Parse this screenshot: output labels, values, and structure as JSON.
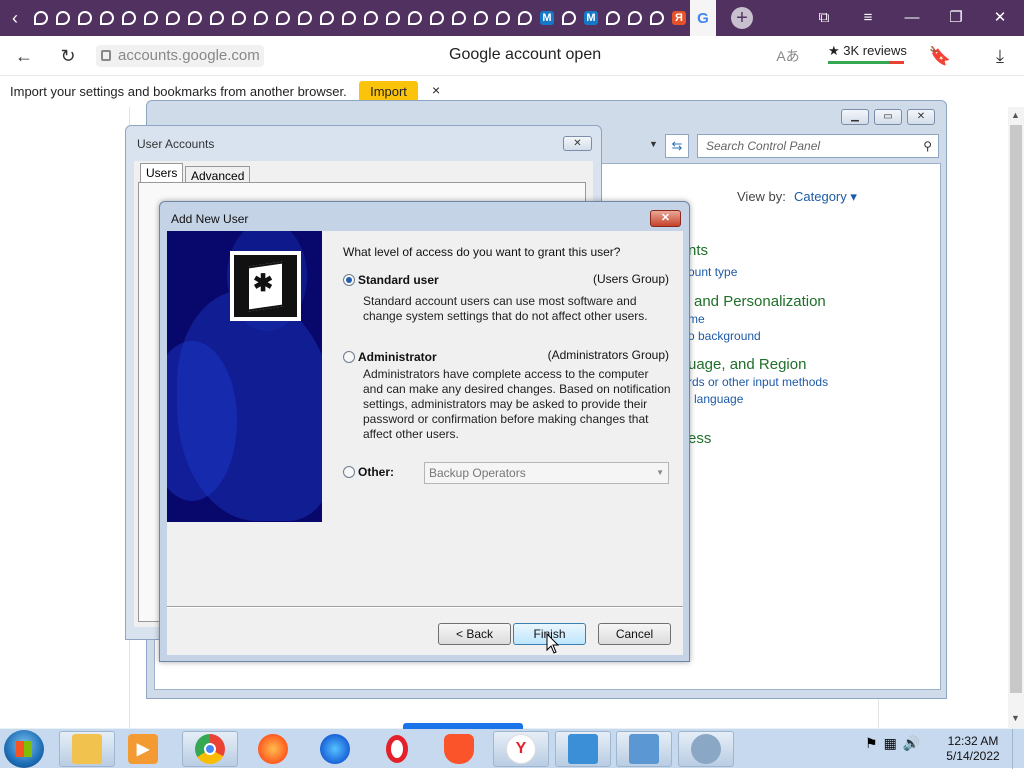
{
  "browser": {
    "tabs": [
      {
        "icon": "p-icon"
      },
      {
        "icon": "p-icon"
      },
      {
        "icon": "p-icon"
      },
      {
        "icon": "p-icon"
      },
      {
        "icon": "p-icon"
      },
      {
        "icon": "p-icon"
      },
      {
        "icon": "p-icon"
      },
      {
        "icon": "p-icon"
      },
      {
        "icon": "p-icon"
      },
      {
        "icon": "p-icon"
      },
      {
        "icon": "p-icon"
      },
      {
        "icon": "p-icon"
      },
      {
        "icon": "p-icon"
      },
      {
        "icon": "p-icon"
      },
      {
        "icon": "p-icon"
      },
      {
        "icon": "p-icon"
      },
      {
        "icon": "p-icon"
      },
      {
        "icon": "p-icon"
      },
      {
        "icon": "p-icon"
      },
      {
        "icon": "p-icon"
      },
      {
        "icon": "p-icon"
      },
      {
        "icon": "p-icon"
      },
      {
        "icon": "p-icon"
      },
      {
        "icon": "m-icon",
        "glyph": "M"
      },
      {
        "icon": "p-icon"
      },
      {
        "icon": "m-icon",
        "glyph": "M"
      },
      {
        "icon": "p-icon"
      },
      {
        "icon": "p-icon"
      },
      {
        "icon": "p-icon"
      },
      {
        "icon": "yandex-icon",
        "glyph": "Я"
      }
    ],
    "active_tab_glyph": "G",
    "new_tab_glyph": "+",
    "url": "accounts.google.com",
    "page_heading": "Google account open",
    "reviews": "★ 3K reviews",
    "import_bar": {
      "message": "Import your settings and bookmarks from another browser.",
      "button": "Import",
      "close": "×"
    }
  },
  "control_panel": {
    "search_placeholder": "Search Control Panel",
    "view_by_label": "View by:",
    "view_by_value": "Category ▾",
    "sections": [
      {
        "heading": "nts",
        "links": [
          "ount type"
        ]
      },
      {
        "heading": "and Personalization",
        "links": [
          "me",
          "o background"
        ]
      },
      {
        "heading": "uage, and Region",
        "links": [
          "rds or other input methods",
          "language"
        ]
      },
      {
        "heading": "ess",
        "links": []
      }
    ]
  },
  "user_accounts": {
    "title": "User Accounts",
    "tabs": [
      "Users",
      "Advanced"
    ]
  },
  "add_user_dialog": {
    "title": "Add New User",
    "question": "What level of access do you want to grant this user?",
    "options": [
      {
        "label": "Standard user",
        "group": "(Users Group)",
        "selected": true,
        "description": [
          "Standard account users can use most software and",
          "change system settings that do not affect other users."
        ]
      },
      {
        "label": "Administrator",
        "group": "(Administrators Group)",
        "selected": false,
        "description": [
          "Administrators have complete access to the computer",
          "and can make any desired changes. Based on notification",
          "settings, administrators may be asked to provide their",
          "password or confirmation before making changes that",
          "affect other users."
        ]
      },
      {
        "label": "Other:",
        "selected": false,
        "select_value": "Backup Operators"
      }
    ],
    "buttons": {
      "back": "< Back",
      "finish": "Finish",
      "cancel": "Cancel"
    }
  },
  "taskbar": {
    "apps": [
      "explorer-icon",
      "media-player-icon",
      "chrome-icon",
      "firefox-icon",
      "firefox-dev-icon",
      "opera-icon",
      "brave-icon",
      "yandex-icon",
      "remote-desktop-icon",
      "control-panel-icon",
      "user-accounts-icon"
    ],
    "time": "12:32 AM",
    "date": "5/14/2022"
  }
}
